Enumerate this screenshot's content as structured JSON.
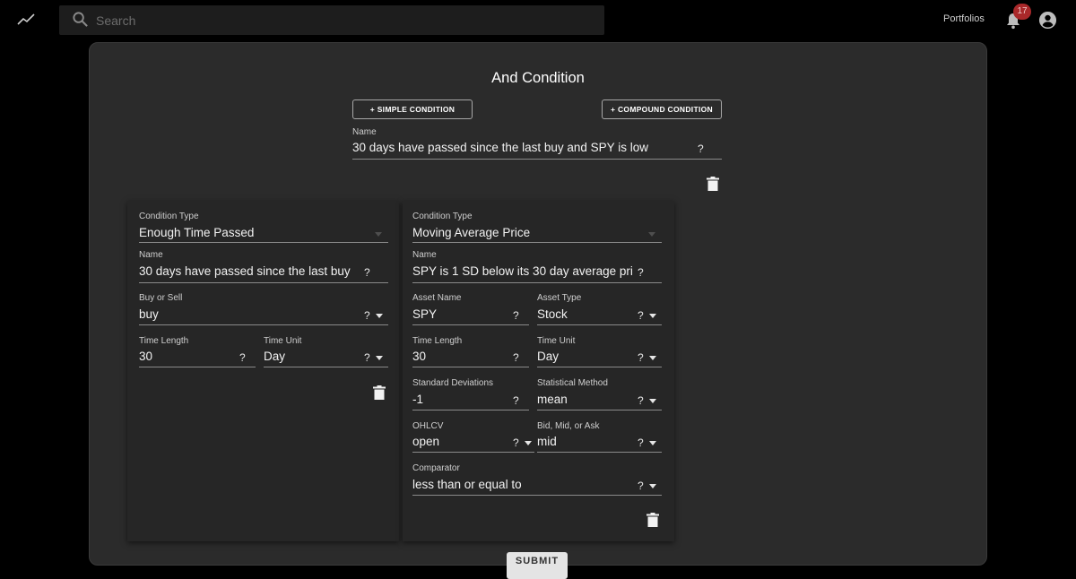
{
  "header": {
    "search_placeholder": "Search",
    "portfolios_label": "Portfolios",
    "notification_count": "17"
  },
  "form": {
    "title": "And Condition",
    "simple_condition_label": "+ SIMPLE CONDITION",
    "compound_condition_label": "+ COMPOUND CONDITION",
    "name_label": "Name",
    "name_value": "30 days have passed since the last buy and SPY is low",
    "help_glyph": "?"
  },
  "left_condition": {
    "condition_type_label": "Condition Type",
    "condition_type_value": "Enough Time Passed",
    "name_label": "Name",
    "name_value": "30 days have passed since the last buy",
    "buy_or_sell_label": "Buy or Sell",
    "buy_or_sell_value": "buy",
    "time_length_label": "Time Length",
    "time_length_value": "30",
    "time_unit_label": "Time Unit",
    "time_unit_value": "Day"
  },
  "right_condition": {
    "condition_type_label": "Condition Type",
    "condition_type_value": "Moving Average Price",
    "name_label": "Name",
    "name_value": "SPY is 1 SD below its 30 day average pric",
    "asset_name_label": "Asset Name",
    "asset_name_value": "SPY",
    "asset_type_label": "Asset Type",
    "asset_type_value": "Stock",
    "time_length_label": "Time Length",
    "time_length_value": "30",
    "time_unit_label": "Time Unit",
    "time_unit_value": "Day",
    "std_dev_label": "Standard Deviations",
    "std_dev_value": "-1",
    "stat_method_label": "Statistical Method",
    "stat_method_value": "mean",
    "ohlcv_label": "OHLCV",
    "ohlcv_value": "open",
    "bid_mid_ask_label": "Bid, Mid, or Ask",
    "bid_mid_ask_value": "mid",
    "comparator_label": "Comparator",
    "comparator_value": "less than or equal to"
  },
  "footer": {
    "submit_label": "SUBMIT"
  },
  "icons": {
    "logo": "trending-line-icon",
    "search": "search-icon",
    "bell": "bell-icon",
    "account": "account-circle-icon",
    "trash": "trash-icon",
    "help": "question-mark",
    "dropdown": "triangle-down"
  },
  "colors": {
    "background": "#000000",
    "panel": "#2b2b2b",
    "card": "#262626",
    "badge": "#a9282a"
  }
}
